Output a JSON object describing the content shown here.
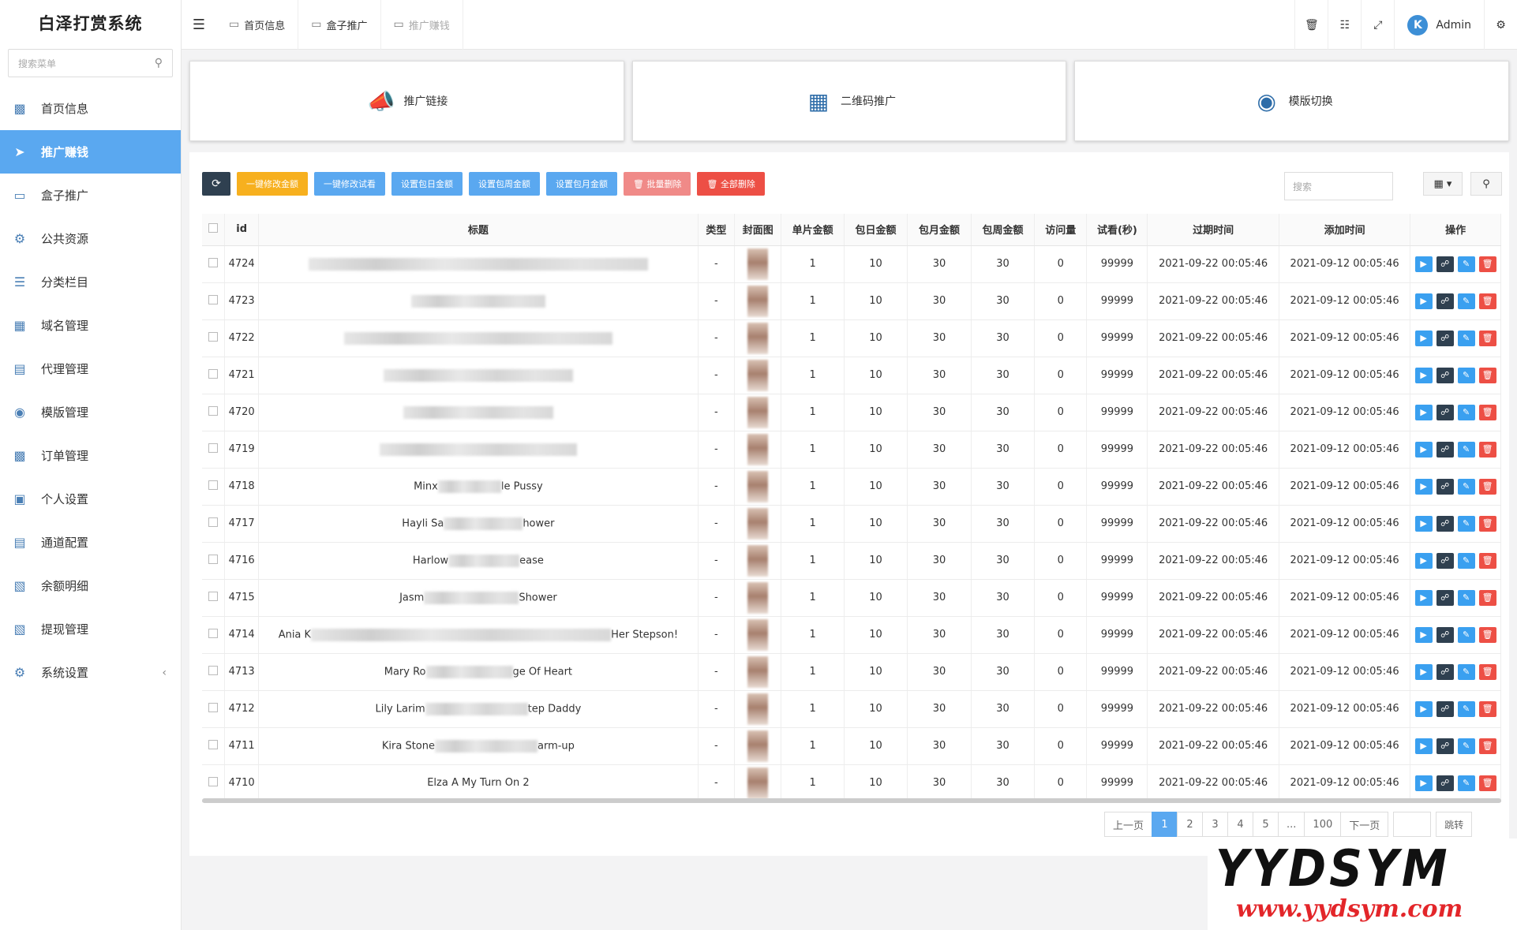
{
  "app": {
    "title": "白泽打赏系统"
  },
  "menu_search": {
    "placeholder": "搜索菜单"
  },
  "menu": [
    {
      "label": "首页信息",
      "icon": "home-icon",
      "active": false
    },
    {
      "label": "推广赚钱",
      "icon": "promote-icon",
      "active": true
    },
    {
      "label": "盒子推广",
      "icon": "box-icon",
      "active": false
    },
    {
      "label": "公共资源",
      "icon": "resource-icon",
      "active": false
    },
    {
      "label": "分类栏目",
      "icon": "category-icon",
      "active": false
    },
    {
      "label": "域名管理",
      "icon": "domain-icon",
      "active": false
    },
    {
      "label": "代理管理",
      "icon": "agent-icon",
      "active": false
    },
    {
      "label": "模版管理",
      "icon": "template-icon",
      "active": false
    },
    {
      "label": "订单管理",
      "icon": "order-icon",
      "active": false
    },
    {
      "label": "个人设置",
      "icon": "profile-icon",
      "active": false
    },
    {
      "label": "通道配置",
      "icon": "channel-icon",
      "active": false
    },
    {
      "label": "余额明细",
      "icon": "balance-icon",
      "active": false
    },
    {
      "label": "提现管理",
      "icon": "withdraw-icon",
      "active": false
    },
    {
      "label": "系统设置",
      "icon": "settings-icon",
      "active": false
    }
  ],
  "topbar": {
    "tabs": [
      {
        "label": "首页信息",
        "muted": false
      },
      {
        "label": "盒子推广",
        "muted": false
      },
      {
        "label": "推广赚钱",
        "muted": true
      }
    ],
    "user": "Admin"
  },
  "cards": [
    {
      "label": "推广链接",
      "icon": "megaphone-icon"
    },
    {
      "label": "二维码推广",
      "icon": "qrcode-icon"
    },
    {
      "label": "模版切换",
      "icon": "html-template-icon"
    }
  ],
  "toolbar": {
    "buttons": [
      {
        "label": "一键修改金额",
        "style": "orange"
      },
      {
        "label": "一键修改试看",
        "style": "blue"
      },
      {
        "label": "设置包日金额",
        "style": "blue"
      },
      {
        "label": "设置包周金额",
        "style": "blue"
      },
      {
        "label": "设置包月金额",
        "style": "blue"
      },
      {
        "label": "批量删除",
        "style": "pink"
      },
      {
        "label": "全部删除",
        "style": "red"
      }
    ],
    "search_placeholder": "搜索"
  },
  "table": {
    "columns": [
      "id",
      "标题",
      "类型",
      "封面图",
      "单片金额",
      "包日金额",
      "包月金额",
      "包周金额",
      "访问量",
      "试看(秒)",
      "过期时间",
      "添加时间",
      "操作"
    ],
    "rows": [
      {
        "id": "4724",
        "pre": "",
        "post": "",
        "blur": 430,
        "type": "-",
        "single": "1",
        "day": "10",
        "month": "30",
        "week": "30",
        "views": "0",
        "trial": "99999",
        "expire": "2021-09-22 00:05:46",
        "added": "2021-09-12 00:05:46"
      },
      {
        "id": "4723",
        "pre": "",
        "post": "",
        "blur": 170,
        "type": "-",
        "single": "1",
        "day": "10",
        "month": "30",
        "week": "30",
        "views": "0",
        "trial": "99999",
        "expire": "2021-09-22 00:05:46",
        "added": "2021-09-12 00:05:46"
      },
      {
        "id": "4722",
        "pre": "",
        "post": "",
        "blur": 340,
        "type": "-",
        "single": "1",
        "day": "10",
        "month": "30",
        "week": "30",
        "views": "0",
        "trial": "99999",
        "expire": "2021-09-22 00:05:46",
        "added": "2021-09-12 00:05:46"
      },
      {
        "id": "4721",
        "pre": "",
        "post": "",
        "blur": 240,
        "type": "-",
        "single": "1",
        "day": "10",
        "month": "30",
        "week": "30",
        "views": "0",
        "trial": "99999",
        "expire": "2021-09-22 00:05:46",
        "added": "2021-09-12 00:05:46"
      },
      {
        "id": "4720",
        "pre": "",
        "post": "",
        "blur": 190,
        "type": "-",
        "single": "1",
        "day": "10",
        "month": "30",
        "week": "30",
        "views": "0",
        "trial": "99999",
        "expire": "2021-09-22 00:05:46",
        "added": "2021-09-12 00:05:46"
      },
      {
        "id": "4719",
        "pre": "",
        "post": "",
        "blur": 250,
        "type": "-",
        "single": "1",
        "day": "10",
        "month": "30",
        "week": "30",
        "views": "0",
        "trial": "99999",
        "expire": "2021-09-22 00:05:46",
        "added": "2021-09-12 00:05:46"
      },
      {
        "id": "4718",
        "pre": "Minx",
        "post": "le Pussy",
        "blur": 80,
        "type": "-",
        "single": "1",
        "day": "10",
        "month": "30",
        "week": "30",
        "views": "0",
        "trial": "99999",
        "expire": "2021-09-22 00:05:46",
        "added": "2021-09-12 00:05:46"
      },
      {
        "id": "4717",
        "pre": "Hayli Sa",
        "post": "hower",
        "blur": 100,
        "type": "-",
        "single": "1",
        "day": "10",
        "month": "30",
        "week": "30",
        "views": "0",
        "trial": "99999",
        "expire": "2021-09-22 00:05:46",
        "added": "2021-09-12 00:05:46"
      },
      {
        "id": "4716",
        "pre": "Harlow",
        "post": "ease",
        "blur": 90,
        "type": "-",
        "single": "1",
        "day": "10",
        "month": "30",
        "week": "30",
        "views": "0",
        "trial": "99999",
        "expire": "2021-09-22 00:05:46",
        "added": "2021-09-12 00:05:46"
      },
      {
        "id": "4715",
        "pre": "Jasm",
        "post": "Shower",
        "blur": 120,
        "type": "-",
        "single": "1",
        "day": "10",
        "month": "30",
        "week": "30",
        "views": "0",
        "trial": "99999",
        "expire": "2021-09-22 00:05:46",
        "added": "2021-09-12 00:05:46"
      },
      {
        "id": "4714",
        "pre": "Ania K",
        "post": "Her Stepson!",
        "blur": 380,
        "type": "-",
        "single": "1",
        "day": "10",
        "month": "30",
        "week": "30",
        "views": "0",
        "trial": "99999",
        "expire": "2021-09-22 00:05:46",
        "added": "2021-09-12 00:05:46"
      },
      {
        "id": "4713",
        "pre": "Mary Ro",
        "post": "ge Of Heart",
        "blur": 110,
        "type": "-",
        "single": "1",
        "day": "10",
        "month": "30",
        "week": "30",
        "views": "0",
        "trial": "99999",
        "expire": "2021-09-22 00:05:46",
        "added": "2021-09-12 00:05:46"
      },
      {
        "id": "4712",
        "pre": "Lily Larim",
        "post": "tep Daddy",
        "blur": 130,
        "type": "-",
        "single": "1",
        "day": "10",
        "month": "30",
        "week": "30",
        "views": "0",
        "trial": "99999",
        "expire": "2021-09-22 00:05:46",
        "added": "2021-09-12 00:05:46"
      },
      {
        "id": "4711",
        "pre": "Kira Stone",
        "post": "arm-up",
        "blur": 130,
        "type": "-",
        "single": "1",
        "day": "10",
        "month": "30",
        "week": "30",
        "views": "0",
        "trial": "99999",
        "expire": "2021-09-22 00:05:46",
        "added": "2021-09-12 00:05:46"
      },
      {
        "id": "4710",
        "pre": "Elza A My Turn On 2",
        "post": "",
        "blur": 0,
        "type": "-",
        "single": "1",
        "day": "10",
        "month": "30",
        "week": "30",
        "views": "0",
        "trial": "99999",
        "expire": "2021-09-22 00:05:46",
        "added": "2021-09-12 00:05:46"
      }
    ]
  },
  "pagination": {
    "prev": "上一页",
    "pages": [
      "1",
      "2",
      "3",
      "4",
      "5",
      "...",
      "100"
    ],
    "current": "1",
    "next": "下一页",
    "jump": "跳转"
  },
  "watermark": {
    "top": "YYDSYM",
    "bottom": "www.yydsym.com"
  },
  "colors": {
    "primary": "#5aa8f0",
    "dark": "#2f4050",
    "orange": "#f7b01e",
    "danger": "#ed4f45",
    "pink": "#f08a88"
  }
}
